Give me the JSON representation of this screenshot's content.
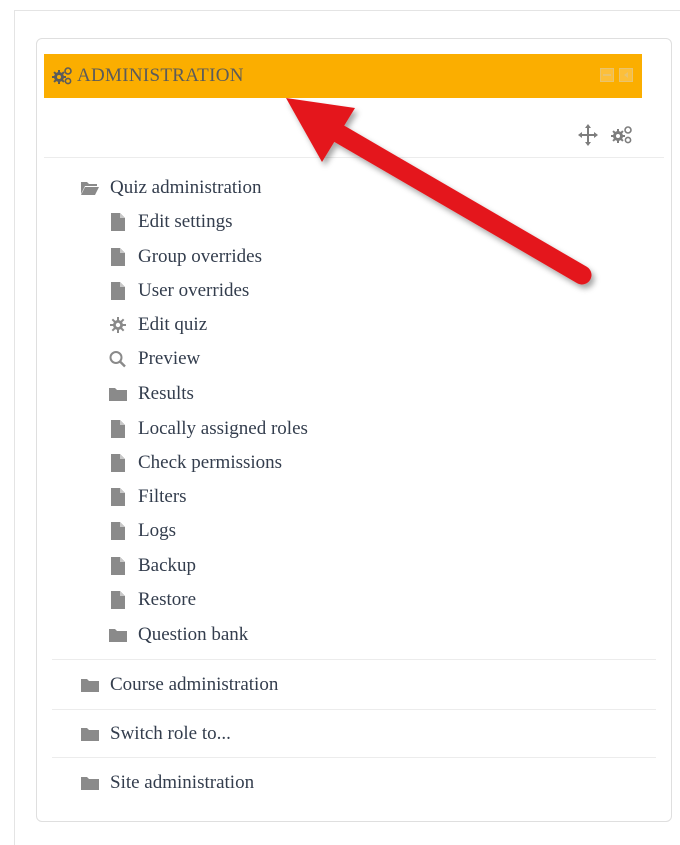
{
  "block": {
    "title": "ADMINISTRATION"
  },
  "tree": {
    "quiz_admin": {
      "label": "Quiz administration",
      "icon": "folder-open-icon"
    },
    "items": [
      {
        "label": "Edit settings",
        "icon": "page-icon"
      },
      {
        "label": "Group overrides",
        "icon": "page-icon"
      },
      {
        "label": "User overrides",
        "icon": "page-icon"
      },
      {
        "label": "Edit quiz",
        "icon": "gear-icon"
      },
      {
        "label": "Preview",
        "icon": "search-icon"
      },
      {
        "label": "Results",
        "icon": "folder-icon"
      },
      {
        "label": "Locally assigned roles",
        "icon": "page-icon"
      },
      {
        "label": "Check permissions",
        "icon": "page-icon"
      },
      {
        "label": "Filters",
        "icon": "page-icon"
      },
      {
        "label": "Logs",
        "icon": "page-icon"
      },
      {
        "label": "Backup",
        "icon": "page-icon"
      },
      {
        "label": "Restore",
        "icon": "page-icon"
      },
      {
        "label": "Question bank",
        "icon": "folder-icon"
      }
    ],
    "sections": [
      {
        "label": "Course administration",
        "icon": "folder-icon"
      },
      {
        "label": "Switch role to...",
        "icon": "folder-icon"
      },
      {
        "label": "Site administration",
        "icon": "folder-icon"
      }
    ]
  },
  "colors": {
    "header_bg": "#fbae00",
    "arrow": "#e4161b",
    "text": "#333d4d",
    "icon": "#8a8a8a"
  }
}
